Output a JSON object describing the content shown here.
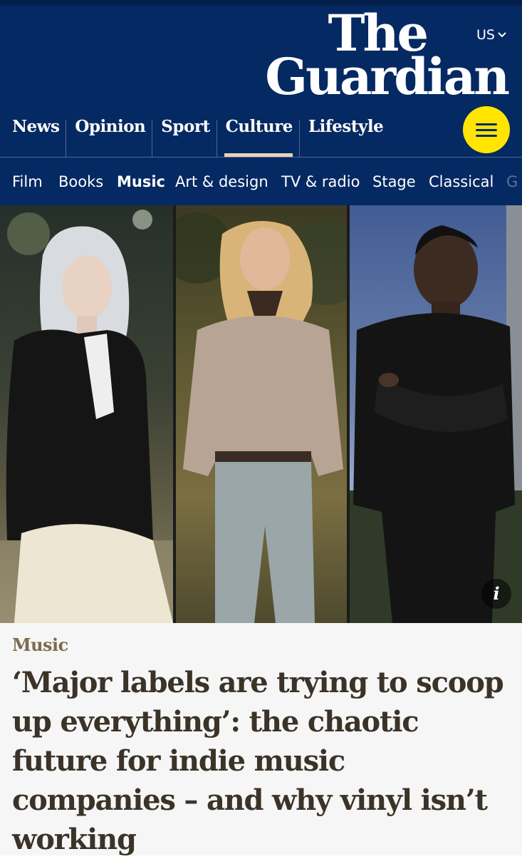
{
  "header": {
    "edition_label": "US",
    "logo_line1": "The",
    "logo_line2": "Guardian",
    "brand_colors": {
      "navy": "#052962",
      "yellow": "#ffe500",
      "culture_accent": "#e7d4b9"
    }
  },
  "pillars": [
    {
      "label": "News"
    },
    {
      "label": "Opinion"
    },
    {
      "label": "Sport"
    },
    {
      "label": "Culture",
      "active": true
    },
    {
      "label": "Lifestyle"
    }
  ],
  "menu_button": {
    "icon": "hamburger-icon"
  },
  "subnav": [
    {
      "label": "Film"
    },
    {
      "label": "Books"
    },
    {
      "label": "Music",
      "active": true
    },
    {
      "label": "Art & design"
    },
    {
      "label": "TV & radio"
    },
    {
      "label": "Stage"
    },
    {
      "label": "Classical"
    },
    {
      "label": "G"
    }
  ],
  "hero": {
    "info_icon": "i",
    "panels": [
      "portrait-woman-blonde-black-blazer",
      "portrait-man-patterned-shirt",
      "portrait-man-black-sweater"
    ]
  },
  "article": {
    "kicker": "Music",
    "headline": "‘Major labels are trying to scoop up everything’: the chaotic future for indie music companies – and why vinyl isn’t working"
  }
}
